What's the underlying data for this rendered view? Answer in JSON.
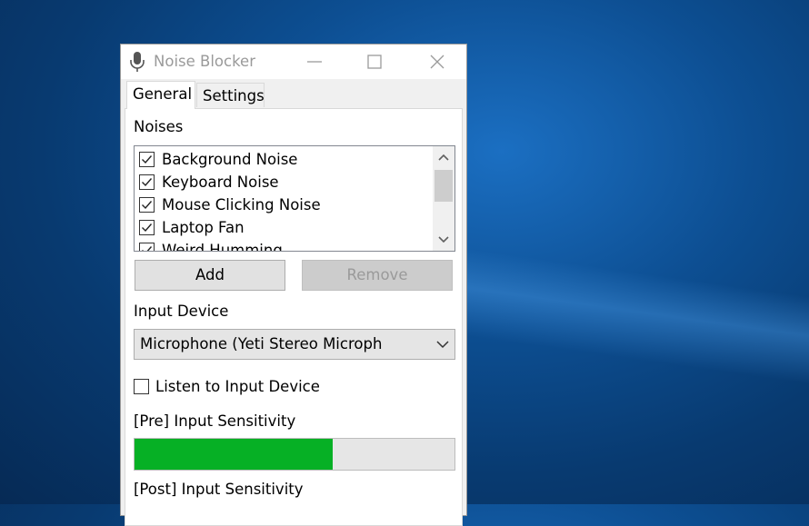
{
  "window": {
    "title": "Noise Blocker",
    "icon": "microphone-icon"
  },
  "tabs": [
    {
      "label": "General",
      "active": true
    },
    {
      "label": "Settings",
      "active": false
    }
  ],
  "general": {
    "noises_label": "Noises",
    "noises": [
      {
        "label": "Background Noise",
        "checked": true
      },
      {
        "label": "Keyboard Noise",
        "checked": true
      },
      {
        "label": "Mouse Clicking Noise",
        "checked": true
      },
      {
        "label": "Laptop Fan",
        "checked": true
      },
      {
        "label": "Weird Humming",
        "checked": true
      }
    ],
    "add_label": "Add",
    "remove_label": "Remove",
    "input_device_label": "Input Device",
    "input_device_value": "Microphone (Yeti Stereo Microph",
    "listen_label": "Listen to Input Device",
    "listen_checked": false,
    "pre_sensitivity_label": "[Pre] Input Sensitivity",
    "pre_sensitivity_level": 0.62,
    "post_sensitivity_label": "[Post] Input Sensitivity"
  },
  "colors": {
    "meter_fill": "#06b025",
    "desktop_blue": "#0d4f93"
  }
}
